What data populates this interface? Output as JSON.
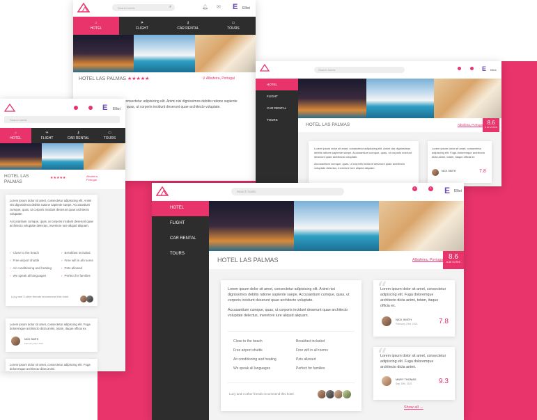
{
  "brand": {
    "accent": "#e8336b",
    "dark": "#2d2d2d"
  },
  "search": {
    "placeholder": "Search hotels"
  },
  "user": {
    "name": "Elliot",
    "initial": "E",
    "notif1": "1",
    "notif2": "2"
  },
  "nav": {
    "hotel": "HOTEL",
    "flight": "FLIGHT",
    "car": "CAR RENTAL",
    "tours": "TOURS"
  },
  "hotel": {
    "name": "HOTEL LAS PALMAS",
    "stars": "★★★★★",
    "location": "Albufeira, Portugal",
    "score": "8.6",
    "votes": "6.3K VOTES"
  },
  "description": {
    "p1": "Lorem ipsum dolor sit amet, consectetur adipisicing elit. Animi nisi dignissimos debitis ratione sapiente saepe. Accusantium cumque, quas, ut corporis incidunt deserunt quae architecto voluptate.",
    "p2": "Accusantium cumque, quas, ut corporis incidunt deserunt quae architecto voluptate delectus, inventore iure aliquid aliquam."
  },
  "amenities": {
    "left": [
      "Close to the beach",
      "Free airport shuttle",
      "Air conditioning and heating",
      "We speak all languages"
    ],
    "right": [
      "Breakfast included",
      "Free wifi in all rooms",
      "Pets allowed",
      "Perfect for families"
    ]
  },
  "friends": {
    "text": "Lucy and 3 other friends recommend this hotel."
  },
  "reviews": [
    {
      "text": "Lorem ipsum dolor sit amet, consectetur adipiscing elit. Fuga doloremque architecto dicta animi, totam, itaque officia ex.",
      "name": "NICK SMITH",
      "date": "February 23rd, 2021",
      "score": "7.8"
    },
    {
      "text": "Lorem ipsum dolor sit amet, consectetur adipiscing elit. Fuga doloremque architecto dicta animi.",
      "name": "MARY THOMAS",
      "date": "Sep 15th, 2021",
      "score": "9.3"
    }
  ],
  "show_all": "Show all →"
}
